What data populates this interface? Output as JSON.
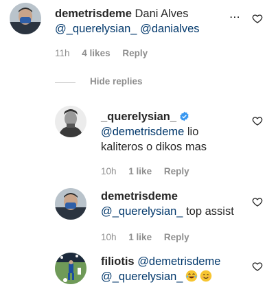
{
  "more_options_label": "⋯",
  "hide_replies_label": "Hide replies",
  "comments": [
    {
      "username": "demetrisdeme",
      "body_text": "Dani Alves",
      "mentions": [
        "@_querelysian_",
        "@danialves"
      ],
      "time": "11h",
      "likes": "4 likes",
      "reply": "Reply"
    },
    {
      "username": "_querelysian_",
      "verified": true,
      "mention": "@demetrisdeme",
      "body_text_1": "lio",
      "body_text_2": "kaliteros o dikos mas",
      "time": "10h",
      "likes": "1 like",
      "reply": "Reply"
    },
    {
      "username": "demetrisdeme",
      "mention": "@_querelysian_",
      "body_text": "top assist",
      "time": "10h",
      "likes": "1 like",
      "reply": "Reply"
    },
    {
      "username": "filiotis",
      "mention_1": "@demetrisdeme",
      "mention_2": "@_querelysian_",
      "emojis": [
        "face-with-tears-of-joy",
        "smiling-face"
      ]
    }
  ],
  "colors": {
    "text": "#262626",
    "mention": "#00376b",
    "meta": "#8e8e8e",
    "verified": "#3897f0"
  }
}
